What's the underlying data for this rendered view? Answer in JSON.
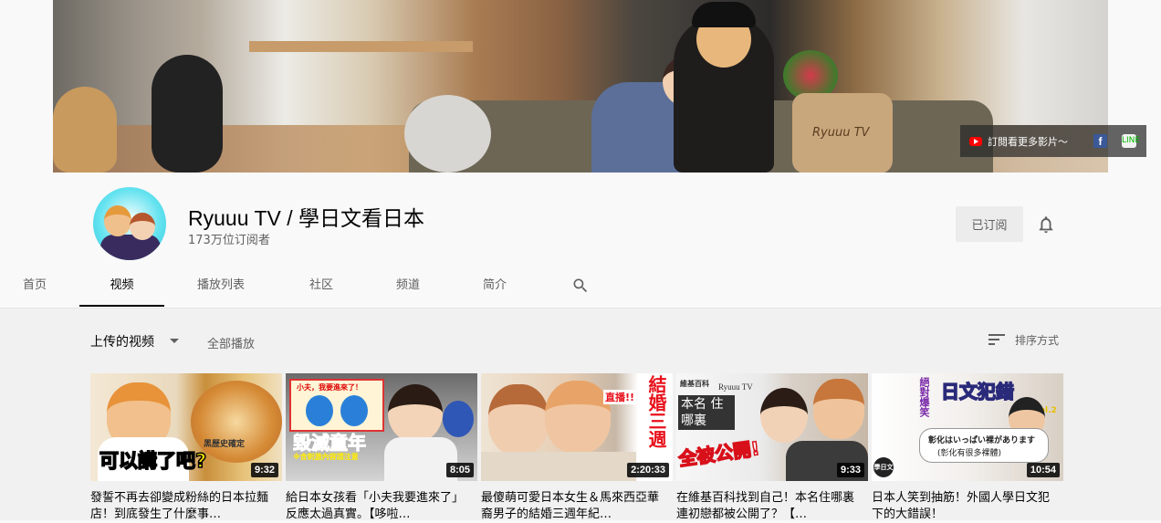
{
  "banner": {
    "links_text": "訂閱看更多影片～",
    "facebook_glyph": "f",
    "line_glyph": "LINE",
    "pillow_text": "Ryuuu TV"
  },
  "channel": {
    "name": "Ryuuu TV / 學日文看日本",
    "subscribers": "173万位订阅者",
    "subscribe_button": "已订阅"
  },
  "tabs": [
    "首页",
    "视频",
    "播放列表",
    "社区",
    "频道",
    "简介"
  ],
  "active_tab": "视频",
  "section": {
    "title": "上传的视频",
    "play_all": "全部播放",
    "sort_label": "排序方式"
  },
  "videos": [
    {
      "title": "發誓不再去卻變成粉絲的日本拉麵店！到底發生了什麼事…",
      "duration": "9:32",
      "overlay": "可以講了吧?",
      "overlay_small": "黑歷史確定"
    },
    {
      "title": "給日本女孩看「小夫我要進來了」反應太過真實。【哆啦…",
      "duration": "8:05",
      "overlay": "毀滅童年",
      "overlay_small": "※含刺激內容請注意",
      "overlay_top": "小夫，我要進來了！"
    },
    {
      "title": "最傻萌可愛日本女生＆馬來西亞華裔男子的結婚三週年紀…",
      "duration": "2:20:33",
      "overlay": "結婚三週",
      "overlay_small": "直播!!"
    },
    {
      "title": "在維基百科找到自己！本名住哪裏連初戀都被公開了？【…",
      "duration": "9:33",
      "overlay": "全被公開!",
      "overlay_small": "本名 住哪裏",
      "overlay_top": "Ryuuu TV",
      "overlay_wiki": "維基百科"
    },
    {
      "title": "日本人笑到抽筋！外國人學日文犯下的大錯誤！",
      "duration": "10:54",
      "overlay": "日文犯錯",
      "overlay_small": "彰化はいっぱい裸があります",
      "overlay_sub": "(彰化有很多裸體)",
      "overlay_vol": "vol.2",
      "overlay_side": "絕對爆笑",
      "overlay_badge": "學日文"
    }
  ]
}
